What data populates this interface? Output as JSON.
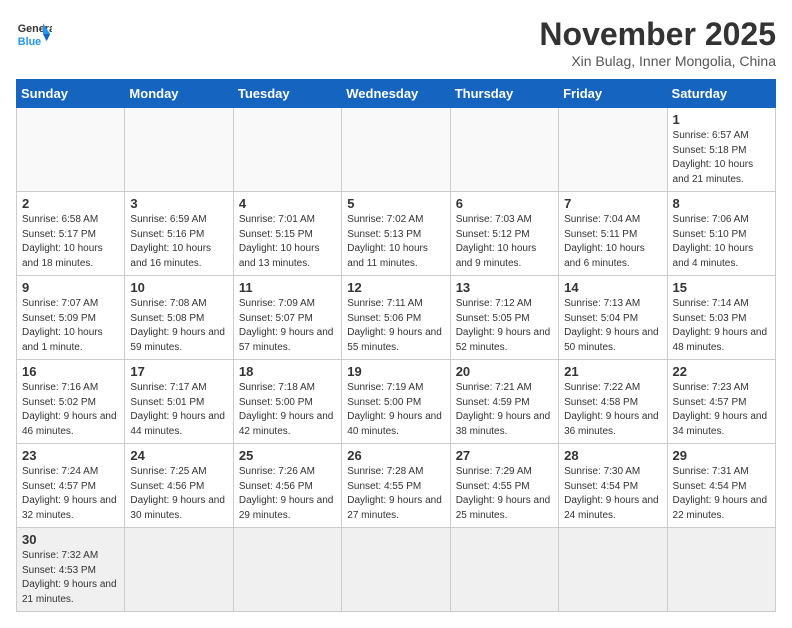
{
  "header": {
    "logo_general": "General",
    "logo_blue": "Blue",
    "title": "November 2025",
    "subtitle": "Xin Bulag, Inner Mongolia, China"
  },
  "days_of_week": [
    "Sunday",
    "Monday",
    "Tuesday",
    "Wednesday",
    "Thursday",
    "Friday",
    "Saturday"
  ],
  "weeks": [
    [
      {
        "day": "",
        "info": ""
      },
      {
        "day": "",
        "info": ""
      },
      {
        "day": "",
        "info": ""
      },
      {
        "day": "",
        "info": ""
      },
      {
        "day": "",
        "info": ""
      },
      {
        "day": "",
        "info": ""
      },
      {
        "day": "1",
        "info": "Sunrise: 6:57 AM\nSunset: 5:18 PM\nDaylight: 10 hours\nand 21 minutes."
      }
    ],
    [
      {
        "day": "2",
        "info": "Sunrise: 6:58 AM\nSunset: 5:17 PM\nDaylight: 10 hours\nand 18 minutes."
      },
      {
        "day": "3",
        "info": "Sunrise: 6:59 AM\nSunset: 5:16 PM\nDaylight: 10 hours\nand 16 minutes."
      },
      {
        "day": "4",
        "info": "Sunrise: 7:01 AM\nSunset: 5:15 PM\nDaylight: 10 hours\nand 13 minutes."
      },
      {
        "day": "5",
        "info": "Sunrise: 7:02 AM\nSunset: 5:13 PM\nDaylight: 10 hours\nand 11 minutes."
      },
      {
        "day": "6",
        "info": "Sunrise: 7:03 AM\nSunset: 5:12 PM\nDaylight: 10 hours\nand 9 minutes."
      },
      {
        "day": "7",
        "info": "Sunrise: 7:04 AM\nSunset: 5:11 PM\nDaylight: 10 hours\nand 6 minutes."
      },
      {
        "day": "8",
        "info": "Sunrise: 7:06 AM\nSunset: 5:10 PM\nDaylight: 10 hours\nand 4 minutes."
      }
    ],
    [
      {
        "day": "9",
        "info": "Sunrise: 7:07 AM\nSunset: 5:09 PM\nDaylight: 10 hours\nand 1 minute."
      },
      {
        "day": "10",
        "info": "Sunrise: 7:08 AM\nSunset: 5:08 PM\nDaylight: 9 hours\nand 59 minutes."
      },
      {
        "day": "11",
        "info": "Sunrise: 7:09 AM\nSunset: 5:07 PM\nDaylight: 9 hours\nand 57 minutes."
      },
      {
        "day": "12",
        "info": "Sunrise: 7:11 AM\nSunset: 5:06 PM\nDaylight: 9 hours\nand 55 minutes."
      },
      {
        "day": "13",
        "info": "Sunrise: 7:12 AM\nSunset: 5:05 PM\nDaylight: 9 hours\nand 52 minutes."
      },
      {
        "day": "14",
        "info": "Sunrise: 7:13 AM\nSunset: 5:04 PM\nDaylight: 9 hours\nand 50 minutes."
      },
      {
        "day": "15",
        "info": "Sunrise: 7:14 AM\nSunset: 5:03 PM\nDaylight: 9 hours\nand 48 minutes."
      }
    ],
    [
      {
        "day": "16",
        "info": "Sunrise: 7:16 AM\nSunset: 5:02 PM\nDaylight: 9 hours\nand 46 minutes."
      },
      {
        "day": "17",
        "info": "Sunrise: 7:17 AM\nSunset: 5:01 PM\nDaylight: 9 hours\nand 44 minutes."
      },
      {
        "day": "18",
        "info": "Sunrise: 7:18 AM\nSunset: 5:00 PM\nDaylight: 9 hours\nand 42 minutes."
      },
      {
        "day": "19",
        "info": "Sunrise: 7:19 AM\nSunset: 5:00 PM\nDaylight: 9 hours\nand 40 minutes."
      },
      {
        "day": "20",
        "info": "Sunrise: 7:21 AM\nSunset: 4:59 PM\nDaylight: 9 hours\nand 38 minutes."
      },
      {
        "day": "21",
        "info": "Sunrise: 7:22 AM\nSunset: 4:58 PM\nDaylight: 9 hours\nand 36 minutes."
      },
      {
        "day": "22",
        "info": "Sunrise: 7:23 AM\nSunset: 4:57 PM\nDaylight: 9 hours\nand 34 minutes."
      }
    ],
    [
      {
        "day": "23",
        "info": "Sunrise: 7:24 AM\nSunset: 4:57 PM\nDaylight: 9 hours\nand 32 minutes."
      },
      {
        "day": "24",
        "info": "Sunrise: 7:25 AM\nSunset: 4:56 PM\nDaylight: 9 hours\nand 30 minutes."
      },
      {
        "day": "25",
        "info": "Sunrise: 7:26 AM\nSunset: 4:56 PM\nDaylight: 9 hours\nand 29 minutes."
      },
      {
        "day": "26",
        "info": "Sunrise: 7:28 AM\nSunset: 4:55 PM\nDaylight: 9 hours\nand 27 minutes."
      },
      {
        "day": "27",
        "info": "Sunrise: 7:29 AM\nSunset: 4:55 PM\nDaylight: 9 hours\nand 25 minutes."
      },
      {
        "day": "28",
        "info": "Sunrise: 7:30 AM\nSunset: 4:54 PM\nDaylight: 9 hours\nand 24 minutes."
      },
      {
        "day": "29",
        "info": "Sunrise: 7:31 AM\nSunset: 4:54 PM\nDaylight: 9 hours\nand 22 minutes."
      }
    ],
    [
      {
        "day": "30",
        "info": "Sunrise: 7:32 AM\nSunset: 4:53 PM\nDaylight: 9 hours\nand 21 minutes."
      },
      {
        "day": "",
        "info": ""
      },
      {
        "day": "",
        "info": ""
      },
      {
        "day": "",
        "info": ""
      },
      {
        "day": "",
        "info": ""
      },
      {
        "day": "",
        "info": ""
      },
      {
        "day": "",
        "info": ""
      }
    ]
  ]
}
